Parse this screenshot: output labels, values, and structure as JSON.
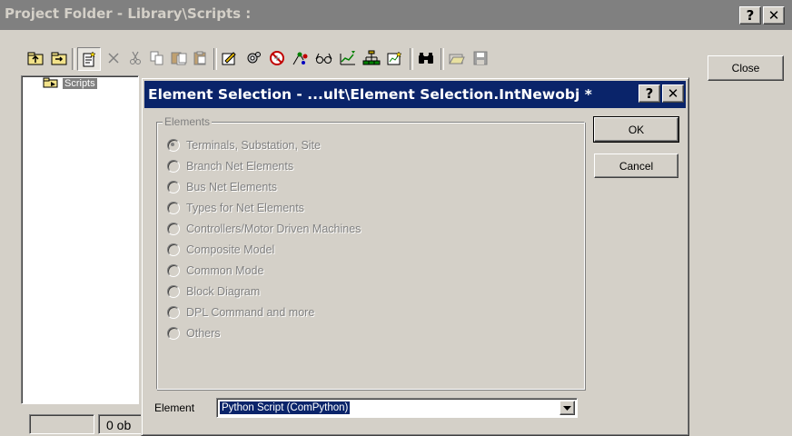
{
  "outer_window": {
    "title": "Project Folder - Library\\Scripts :",
    "help_label": "?",
    "close_glyph": "✕"
  },
  "toolbar": {
    "tools": [
      "folder-up-icon",
      "folder-down-icon",
      "new-object-icon",
      "delete-icon",
      "cut-icon",
      "copy-icon",
      "paste-icon",
      "paste-special-icon",
      "edit-icon",
      "settings-icon",
      "forbidden-icon",
      "graphics-icon",
      "glasses-icon",
      "filter-icon",
      "tree-icon",
      "edit-chart-icon",
      "binoculars-icon",
      "open-folder-icon",
      "save-icon"
    ]
  },
  "side": {
    "close_label": "Close"
  },
  "tree": {
    "item_label": "Scripts"
  },
  "status": {
    "count_text": "0 ob"
  },
  "dialog": {
    "title": "Element Selection - ...ult\\Element Selection.IntNewobj *",
    "help_label": "?",
    "close_glyph": "✕",
    "ok_label": "OK",
    "cancel_label": "Cancel",
    "group_label": "Elements",
    "options": [
      {
        "label": "Terminals, Substation, Site",
        "selected": true
      },
      {
        "label": "Branch Net Elements",
        "selected": false
      },
      {
        "label": "Bus Net Elements",
        "selected": false
      },
      {
        "label": "Types for Net Elements",
        "selected": false
      },
      {
        "label": "Controllers/Motor Driven Machines",
        "selected": false
      },
      {
        "label": "Composite Model",
        "selected": false
      },
      {
        "label": "Common Mode",
        "selected": false
      },
      {
        "label": "Block Diagram",
        "selected": false
      },
      {
        "label": "DPL Command and more",
        "selected": false
      },
      {
        "label": "Others",
        "selected": false
      }
    ],
    "element_label": "Element",
    "element_value": "Python Script (ComPython)"
  },
  "colors": {
    "active_title": "#0a246a",
    "inactive_title": "#808080",
    "face": "#d4d0c8"
  }
}
